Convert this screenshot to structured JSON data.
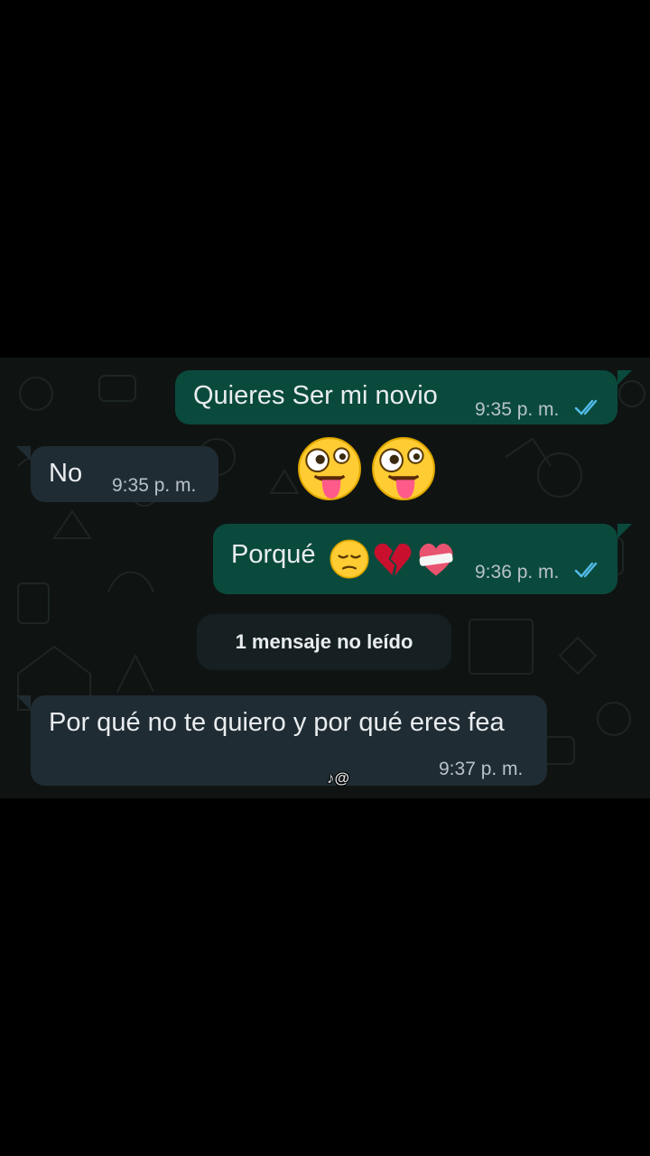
{
  "messages": [
    {
      "direction": "outgoing",
      "text": "Quieres Ser mi novio",
      "time": "9:35 p. m.",
      "status": "read"
    },
    {
      "direction": "incoming",
      "text": "No",
      "time": "9:35 p. m."
    },
    {
      "direction": "outgoing",
      "emojis": [
        "zany-face",
        "zany-face"
      ]
    },
    {
      "direction": "outgoing",
      "text": "Porqué",
      "emojis": [
        "pensive-face",
        "broken-heart",
        "mending-heart"
      ],
      "time": "9:36 p. m.",
      "status": "read"
    },
    {
      "direction": "incoming",
      "text": "Por qué no te quiero y por qué eres fea",
      "time": "9:37 p. m."
    }
  ],
  "unread_label": "1 mensaje no leído",
  "watermark": "@",
  "colors": {
    "outgoing_bubble": "#0a4a3d",
    "incoming_bubble": "#202c33",
    "read_ticks": "#53bdeb",
    "chat_background": "#0f1413"
  }
}
